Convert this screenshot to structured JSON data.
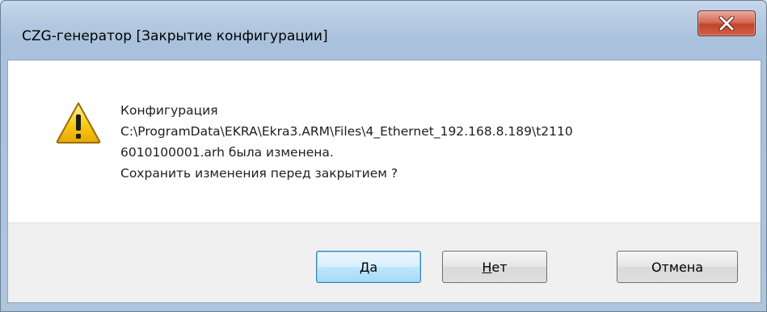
{
  "window": {
    "title": "CZG-генератор [Закрытие конфигурации]",
    "close_icon": "close-icon"
  },
  "dialog": {
    "icon": "warning-icon",
    "lines": [
      "Конфигурация",
      "C:\\ProgramData\\EKRA\\Ekra3.ARM\\Files\\4_Ethernet_192.168.8.189\\t2110",
      "6010100001.arh была изменена.",
      "Сохранить изменения перед закрытием ?"
    ]
  },
  "buttons": {
    "yes": "Да",
    "no_first": "Н",
    "no_rest": "ет",
    "cancel": "Отмена"
  },
  "colors": {
    "warning_fill": "#f5c400",
    "close_button": "#c2442c"
  }
}
